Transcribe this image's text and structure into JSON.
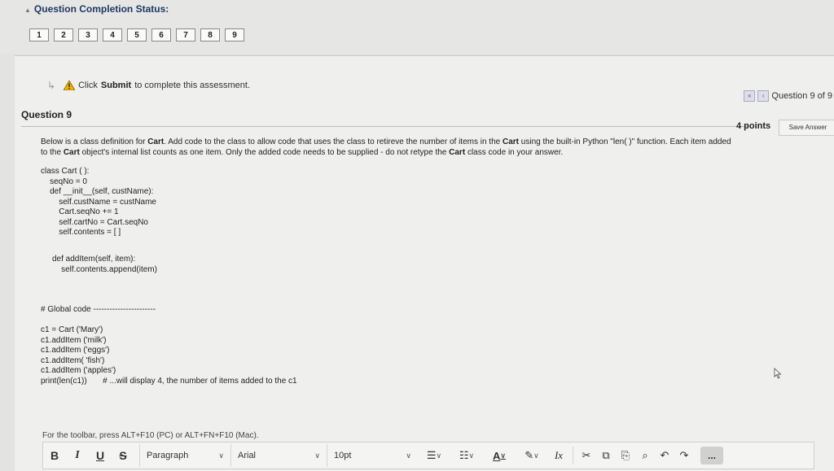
{
  "status": {
    "title": "Question Completion Status:",
    "questions": [
      "1",
      "2",
      "3",
      "4",
      "5",
      "6",
      "7",
      "8",
      "9"
    ]
  },
  "notice": {
    "prefix": "Click",
    "action": "Submit",
    "suffix": "to complete this assessment."
  },
  "pager": {
    "label": "Question 9 of 9"
  },
  "question": {
    "title": "Question 9",
    "points": "4 points",
    "save_label": "Save Answer",
    "line1_a": "Below is a class definition for",
    "line1_b": "Cart",
    "line1_c": ". Add code to the class to allow code that uses the class to retireve the number of items in the",
    "line1_d": "Cart",
    "line1_e": "using the built-in Python \"len( )\" function. Each item added",
    "line2_a": "to the",
    "line2_b": "Cart",
    "line2_c": "object's internal list counts as one item. Only the added code needs to be supplied - do not retype the",
    "line2_d": "Cart",
    "line2_e": "class code in your answer."
  },
  "code": {
    "class_block": "class Cart ( ):\n    seqNo = 0\n    def __init__(self, custName):\n        self.custName = custName\n        Cart.seqNo += 1\n        self.cartNo = Cart.seqNo\n        self.contents = [ ]",
    "method_block": "def addItem(self, item):\n    self.contents.append(item)",
    "global_block": "# Global code -----------------------\n\nc1 = Cart ('Mary')\nc1.addItem ('milk')\nc1.addItem ('eggs')\nc1.addItem( 'fish')\nc1.addItem ('apples')\nprint(len(c1))       # ...will display 4, the number of items added to the c1"
  },
  "editor": {
    "hint": "For the toolbar, press ALT+F10 (PC) or ALT+FN+F10 (Mac).",
    "bold": "B",
    "italic": "I",
    "underline": "U",
    "strike": "S",
    "paragraph": "Paragraph",
    "font": "Arial",
    "size": "10pt",
    "more": "..."
  }
}
